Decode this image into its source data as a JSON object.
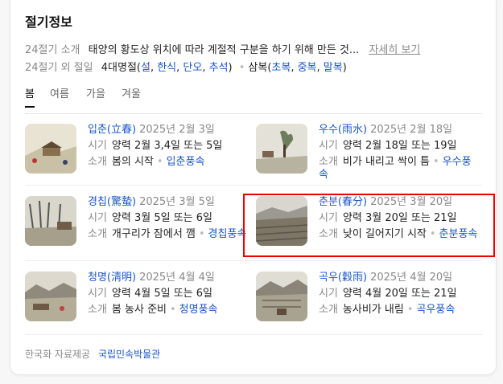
{
  "title": "절기정보",
  "summary": {
    "label": "24절기 소개",
    "text": "태양의 황도상 위치에 따라 계절적 구분을 하기 위해 만든 것...",
    "more": "자세히 보기"
  },
  "extra": {
    "label": "24절기 외 절일",
    "four_label": "4대명절(",
    "four": [
      "설",
      "한식",
      "단오",
      "추석"
    ],
    "four_close": ")",
    "sam_label": "삼복(",
    "sam": [
      "초복",
      "중복",
      "말복"
    ],
    "sam_close": ")"
  },
  "tabs": [
    "봄",
    "여름",
    "가을",
    "겨울"
  ],
  "labels": {
    "period": "시기",
    "intro": "소개"
  },
  "terms": [
    {
      "name": "입춘(立春)",
      "date": "2025년 2월 3일",
      "period": "양력 2월 3,4일 또는 5일",
      "intro": "봄의 시작",
      "link": "입춘풍속"
    },
    {
      "name": "우수(雨水)",
      "date": "2025년 2월 18일",
      "period": "양력 2월 18일 또는 19일",
      "intro": "비가 내리고 싹이 틈",
      "link": "우수풍속"
    },
    {
      "name": "경칩(驚蟄)",
      "date": "2025년 3월 5일",
      "period": "양력 3월 5일 또는 6일",
      "intro": "개구리가 잠에서 깸",
      "link": "경칩풍속"
    },
    {
      "name": "춘분(春分)",
      "date": "2025년 3월 20일",
      "period": "양력 3월 20일 또는 21일",
      "intro": "낮이 길어지기 시작",
      "link": "춘분풍속"
    },
    {
      "name": "청명(淸明)",
      "date": "2025년 4월 4일",
      "period": "양력 4월 5일 또는 6일",
      "intro": "봄 농사 준비",
      "link": "청명풍속"
    },
    {
      "name": "곡우(穀雨)",
      "date": "2025년 4월 20일",
      "period": "양력 4월 20일 또는 21일",
      "intro": "농사비가 내림",
      "link": "곡우풍속"
    }
  ],
  "footer": {
    "label": "한국화 자료제공",
    "source": "국립민속박물관"
  }
}
